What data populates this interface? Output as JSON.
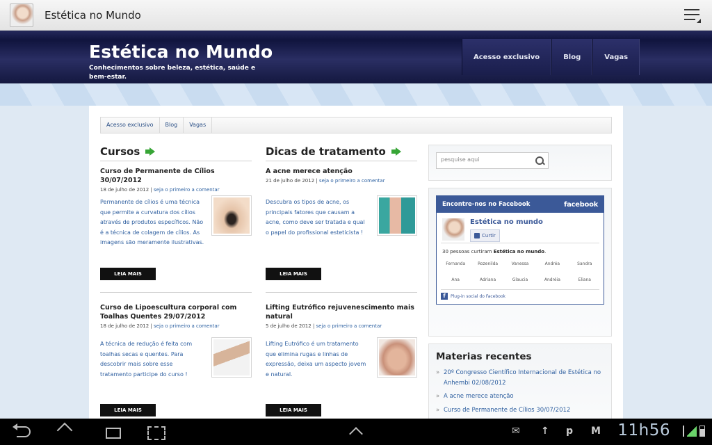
{
  "app_bar": {
    "title": "Estética no Mundo"
  },
  "header": {
    "site_title": "Estética no Mundo",
    "tagline": "Conhecimentos sobre beleza, estética, saúde e bem-estar.",
    "nav": [
      "Acesso exclusivo",
      "Blog",
      "Vagas"
    ]
  },
  "sub_nav": [
    "Acesso exclusivo",
    "Blog",
    "Vagas"
  ],
  "cursos": {
    "heading": "Cursos",
    "posts": [
      {
        "title": "Curso de Permanente de Cílios 30/07/2012",
        "date": "18 de julho de 2012",
        "comment_link": "seja o primeiro a comentar",
        "excerpt": "Permanente de cílios é uma técnica que permite a curvatura dos cílios através de produtos específicos. Não é a técnica de colagem de cílios. As imagens são meramente ilustrativas.",
        "read_more": "LEIA MAIS"
      },
      {
        "title": "Curso de Lipoescultura corporal com Toalhas Quentes 29/07/2012",
        "date": "18 de julho de 2012",
        "comment_link": "seja o primeiro a comentar",
        "excerpt": "A técnica de redução é feita com toalhas secas e quentes. Para descobrir mais sobre esse tratamento participe do curso !",
        "read_more": "LEIA MAIS"
      }
    ]
  },
  "dicas": {
    "heading": "Dicas de tratamento",
    "posts": [
      {
        "title": "A acne merece atenção",
        "date": "21 de julho de 2012",
        "comment_link": "seja o primeiro a comentar",
        "excerpt": "Descubra os tipos de acne, os principais fatores que causam a acne, como deve ser tratada e qual o papel do profissional esteticista !",
        "read_more": "LEIA MAIS"
      },
      {
        "title": "Lifting Eutrófico rejuvenescimento mais natural",
        "date": "5 de julho de 2012",
        "comment_link": "seja o primeiro a comentar",
        "excerpt": "Lifting Eutrófico é um tratamento que elimina rugas e linhas de expressão, deixa um aspecto jovem e natural.",
        "read_more": "LEIA MAIS"
      }
    ]
  },
  "search": {
    "placeholder": "pesquise aqui"
  },
  "facebook": {
    "header": "Encontre-nos no Facebook",
    "logo": "facebook",
    "page_name": "Estética no mundo",
    "like_label": "Curtir",
    "count_prefix": "30 pessoas curtiram",
    "count_page": "Estética no mundo",
    "fans": [
      "Fernanda",
      "Rozenilda",
      "Vanessa",
      "Andréa",
      "Sandra",
      "Ana",
      "Adriana",
      "Glaucia",
      "Andréia",
      "Eliana"
    ],
    "footer": "Plug-in social do Facebook"
  },
  "recent": {
    "title": "Materias recentes",
    "items": [
      "20º Congresso Científico Internacional de Estética no Anhembi 02/08/2012",
      "A acne merece atenção",
      "Curso de Permanente de Cílios 30/07/2012"
    ]
  },
  "system_bar": {
    "clock": "11h56"
  },
  "colors": {
    "header_navy": "#1a1e4c",
    "link_blue": "#2d5e9f",
    "facebook_blue": "#3b5998",
    "arrow_green": "#37a536"
  }
}
